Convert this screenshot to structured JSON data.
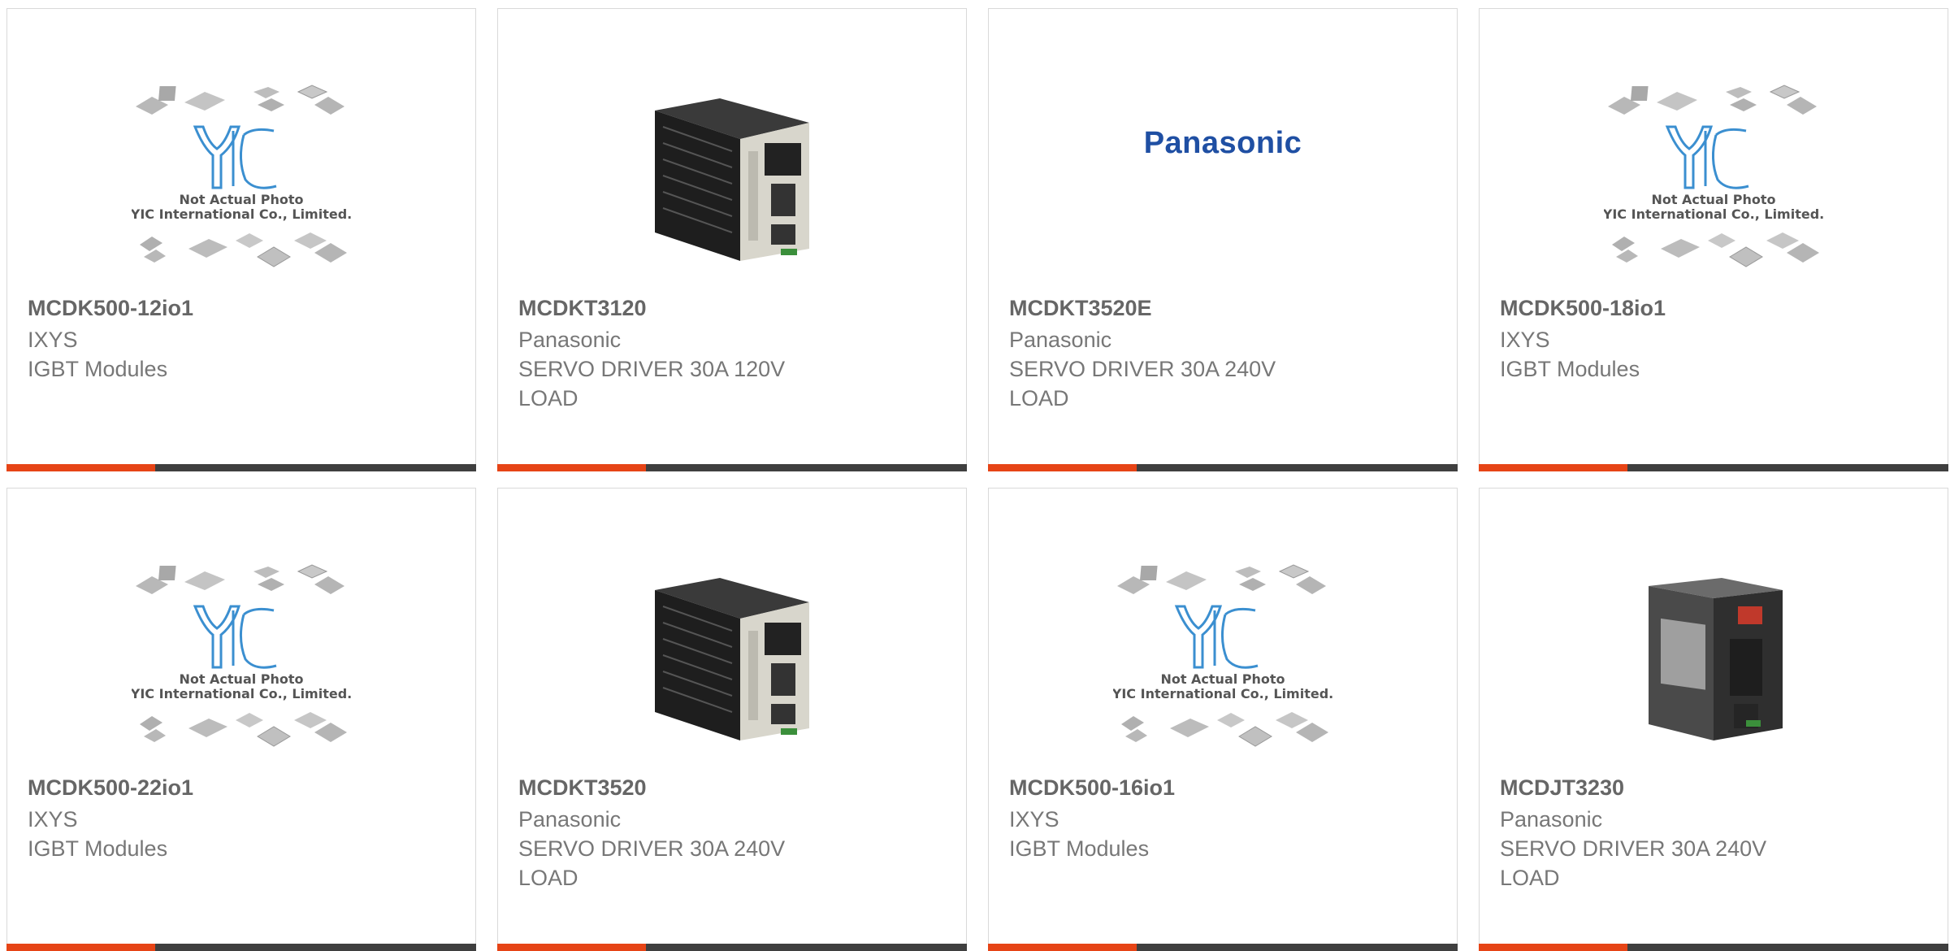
{
  "products": [
    {
      "part": "MCDK500-12io1",
      "manufacturer": "IXYS",
      "description": "IGBT Modules",
      "image": "yic-placeholder-icon"
    },
    {
      "part": "MCDKT3120",
      "manufacturer": "Panasonic",
      "description": "SERVO DRIVER 30A 120V LOAD",
      "image": "servo-driver-icon"
    },
    {
      "part": "MCDKT3520E",
      "manufacturer": "Panasonic",
      "description": "SERVO DRIVER 30A 240V LOAD",
      "image": "panasonic-logo"
    },
    {
      "part": "MCDK500-18io1",
      "manufacturer": "IXYS",
      "description": "IGBT Modules",
      "image": "yic-placeholder-icon"
    },
    {
      "part": "MCDK500-22io1",
      "manufacturer": "IXYS",
      "description": "IGBT Modules",
      "image": "yic-placeholder-icon"
    },
    {
      "part": "MCDKT3520",
      "manufacturer": "Panasonic",
      "description": "SERVO DRIVER 30A 240V LOAD",
      "image": "servo-driver-icon"
    },
    {
      "part": "MCDK500-16io1",
      "manufacturer": "IXYS",
      "description": "IGBT Modules",
      "image": "yic-placeholder-icon"
    },
    {
      "part": "MCDJT3230",
      "manufacturer": "Panasonic",
      "description": "SERVO DRIVER 30A 240V LOAD",
      "image": "servo-driver-gray-icon"
    }
  ],
  "placeholder": {
    "brand": "YIC",
    "line1": "Not Actual Photo",
    "line2": "YIC International Co., Limited."
  },
  "panasonic_logo": {
    "text": "Panasonic",
    "color": "#1f4fa3"
  },
  "colors": {
    "accent": "#e64416",
    "bar": "#3f3f3f",
    "text": "#777777",
    "border": "#d9d9d9"
  }
}
